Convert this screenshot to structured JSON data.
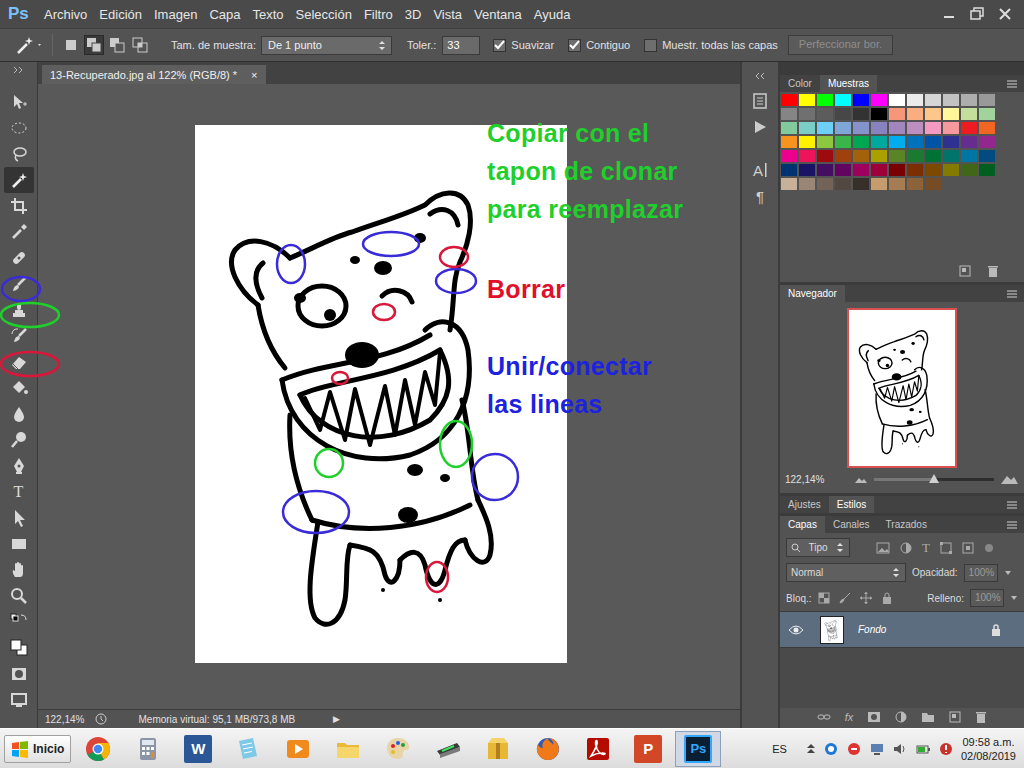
{
  "app": {
    "logo": "Ps"
  },
  "menu": [
    "Archivo",
    "Edición",
    "Imagen",
    "Capa",
    "Texto",
    "Selección",
    "Filtro",
    "3D",
    "Vista",
    "Ventana",
    "Ayuda"
  ],
  "options_bar": {
    "selection_modes": [
      {
        "selected": false
      },
      {
        "selected": true
      },
      {
        "selected": false
      },
      {
        "selected": false
      }
    ],
    "sample_size_label": "Tam. de muestra:",
    "sample_size_value": "De 1 punto",
    "tolerance_label": "Toler.:",
    "tolerance_value": "33",
    "checkboxes": [
      {
        "label": "Suavizar",
        "checked": true
      },
      {
        "label": "Contiguo",
        "checked": true
      },
      {
        "label": "Muestr. todas las capas",
        "checked": false
      }
    ],
    "refine_button": {
      "label": "Perfeccionar bor.",
      "disabled": true
    }
  },
  "tools": [
    {
      "kind": "move",
      "selected": false
    },
    {
      "kind": "marquee",
      "selected": false
    },
    {
      "kind": "lasso",
      "selected": false
    },
    {
      "kind": "magic-wand",
      "selected": true
    },
    {
      "kind": "crop",
      "selected": false
    },
    {
      "kind": "eyedropper",
      "selected": false
    },
    {
      "kind": "healing",
      "selected": false
    },
    {
      "kind": "brush",
      "selected": false
    },
    {
      "kind": "stamp",
      "selected": false
    },
    {
      "kind": "history-brush",
      "selected": false
    },
    {
      "kind": "eraser",
      "selected": false
    },
    {
      "kind": "bucket",
      "selected": false
    },
    {
      "kind": "blur",
      "selected": false
    },
    {
      "kind": "dodge",
      "selected": false
    },
    {
      "kind": "pen",
      "selected": false
    },
    {
      "kind": "text",
      "glyph": "T",
      "selected": false
    },
    {
      "kind": "path-select",
      "selected": false
    },
    {
      "kind": "rectangle",
      "selected": false
    },
    {
      "kind": "hand",
      "selected": false
    },
    {
      "kind": "zoom",
      "selected": false
    },
    {
      "kind": "swap",
      "selected": false
    },
    {
      "kind": "colors",
      "selected": false
    },
    {
      "kind": "quick-mask",
      "selected": false
    },
    {
      "kind": "screen-mode",
      "selected": false
    }
  ],
  "document": {
    "tab_title": "13-Recuperado.jpg al 122% (RGB/8) *",
    "close": "×"
  },
  "annotations": [
    {
      "lines": [
        "Copiar con el",
        "tapon de clonar",
        "para reemplazar"
      ],
      "color": "#1fcf2b"
    },
    {
      "lines": [
        "Borrar"
      ],
      "color": "#e0102c"
    },
    {
      "lines": [
        "Unir/conectar",
        "las lineas"
      ],
      "color": "#1c22e0"
    }
  ],
  "marks": [
    {
      "color": "#3a2bd8"
    },
    {
      "color": "#1fcf2b"
    },
    {
      "color": "#d9173a"
    },
    {
      "color": "#3a2bd8"
    },
    {
      "color": "#3a2bd8"
    },
    {
      "color": "#3a2bd8"
    },
    {
      "color": "#3a2bd8"
    },
    {
      "color": "#3a2bd8"
    },
    {
      "color": "#d9173a"
    },
    {
      "color": "#d9173a"
    },
    {
      "color": "#d9173a"
    },
    {
      "color": "#d9173a"
    },
    {
      "color": "#1fcf2b"
    },
    {
      "color": "#1fcf2b"
    }
  ],
  "status_bar": {
    "zoom": "122,14%",
    "info": "Memoria virtual: 95,1 MB/973,8 MB",
    "arrow": "▶"
  },
  "side_strip": [
    {
      "kind": "history"
    },
    {
      "kind": "actions"
    },
    {
      "kind": "character",
      "glyph": "A"
    },
    {
      "kind": "paragraph",
      "glyph": "¶"
    }
  ],
  "swatches_panel": {
    "tabs": [
      {
        "label": "Color",
        "selected": false
      },
      {
        "label": "Muestras",
        "selected": true
      }
    ],
    "swatches": [
      {
        "color": "#ff0000"
      },
      {
        "color": "#ffff00"
      },
      {
        "color": "#00ff00"
      },
      {
        "color": "#00ffff"
      },
      {
        "color": "#0000ff"
      },
      {
        "color": "#ff00ff"
      },
      {
        "color": "#ffffff"
      },
      {
        "color": "#ebebeb"
      },
      {
        "color": "#d6d6d6"
      },
      {
        "color": "#c2c2c2"
      },
      {
        "color": "#adadad"
      },
      {
        "color": "#999999"
      },
      {
        "color": "#858585"
      },
      {
        "color": "#707070"
      },
      {
        "color": "#5c5c5c"
      },
      {
        "color": "#474747"
      },
      {
        "color": "#333333"
      },
      {
        "color": "#000000"
      },
      {
        "color": "#f7977a"
      },
      {
        "color": "#f9ad81"
      },
      {
        "color": "#fdc68a"
      },
      {
        "color": "#fff79a"
      },
      {
        "color": "#c4df9b"
      },
      {
        "color": "#a2d39c"
      },
      {
        "color": "#82ca9d"
      },
      {
        "color": "#7bcdc8"
      },
      {
        "color": "#6ecff6"
      },
      {
        "color": "#7ea7d8"
      },
      {
        "color": "#8493ca"
      },
      {
        "color": "#8882be"
      },
      {
        "color": "#a187be"
      },
      {
        "color": "#bc8dbf"
      },
      {
        "color": "#f49ac2"
      },
      {
        "color": "#f6989d"
      },
      {
        "color": "#ed1c24"
      },
      {
        "color": "#f26522"
      },
      {
        "color": "#f7941d"
      },
      {
        "color": "#fff200"
      },
      {
        "color": "#8dc73f"
      },
      {
        "color": "#39b54a"
      },
      {
        "color": "#00a651"
      },
      {
        "color": "#00a99d"
      },
      {
        "color": "#00aeef"
      },
      {
        "color": "#0072bc"
      },
      {
        "color": "#0054a6"
      },
      {
        "color": "#2e3192"
      },
      {
        "color": "#662d91"
      },
      {
        "color": "#92278f"
      },
      {
        "color": "#ec008c"
      },
      {
        "color": "#ed145b"
      },
      {
        "color": "#9e0b0f"
      },
      {
        "color": "#a0410d"
      },
      {
        "color": "#a36209"
      },
      {
        "color": "#aba000"
      },
      {
        "color": "#598527"
      },
      {
        "color": "#1a7b30"
      },
      {
        "color": "#007236"
      },
      {
        "color": "#00746b"
      },
      {
        "color": "#0076a3"
      },
      {
        "color": "#004b80"
      },
      {
        "color": "#003471"
      },
      {
        "color": "#1b1464"
      },
      {
        "color": "#440e62"
      },
      {
        "color": "#630460"
      },
      {
        "color": "#9e005d"
      },
      {
        "color": "#9e0039"
      },
      {
        "color": "#790000"
      },
      {
        "color": "#7b2e00"
      },
      {
        "color": "#7d4900"
      },
      {
        "color": "#827b00"
      },
      {
        "color": "#406618"
      },
      {
        "color": "#005e20"
      },
      {
        "color": "#c7b299"
      },
      {
        "color": "#998675"
      },
      {
        "color": "#736357"
      },
      {
        "color": "#534741"
      },
      {
        "color": "#37302a"
      },
      {
        "color": "#c69c6d"
      },
      {
        "color": "#a67c52"
      },
      {
        "color": "#8c6239"
      },
      {
        "color": "#754c24"
      }
    ]
  },
  "navigator": {
    "title": "Navegador",
    "zoom": "122,14%",
    "level": 0.5
  },
  "styles_panel": {
    "tabs": [
      {
        "label": "Ajustes",
        "selected": false
      },
      {
        "label": "Estilos",
        "selected": true
      }
    ]
  },
  "layers_panel": {
    "tabs": [
      {
        "label": "Capas",
        "selected": true
      },
      {
        "label": "Canales",
        "selected": false
      },
      {
        "label": "Trazados",
        "selected": false
      }
    ],
    "filter": "Tipo",
    "filter_text_glyph": "T",
    "blend_mode": "Normal",
    "opacity_label": "Opacidad:",
    "opacity": "100%",
    "lock_label": "Bloq.:",
    "fill_label": "Relleno:",
    "fill": "100%",
    "values_disabled": true,
    "layers": [
      {
        "name": "Fondo",
        "visible": true,
        "selected": true,
        "locked": true
      }
    ],
    "footer_fx": "fx"
  },
  "taskbar": {
    "start": "Inicio",
    "apps": [
      {
        "kind": "chrome",
        "active": false
      },
      {
        "kind": "calculator",
        "active": false
      },
      {
        "kind": "word",
        "label": "W",
        "active": false
      },
      {
        "kind": "notes",
        "active": false
      },
      {
        "kind": "media",
        "active": false
      },
      {
        "kind": "explorer",
        "active": false
      },
      {
        "kind": "paint",
        "active": false
      },
      {
        "kind": "scanner",
        "active": false
      },
      {
        "kind": "archive",
        "active": false
      },
      {
        "kind": "firefox",
        "active": false
      },
      {
        "kind": "acrobat",
        "active": false
      },
      {
        "kind": "powerpoint",
        "label": "P",
        "active": false
      },
      {
        "kind": "photoshop",
        "label": "Ps",
        "active": true
      }
    ],
    "language": "ES",
    "time": "09:58 a.m.",
    "date": "02/08/2019"
  }
}
